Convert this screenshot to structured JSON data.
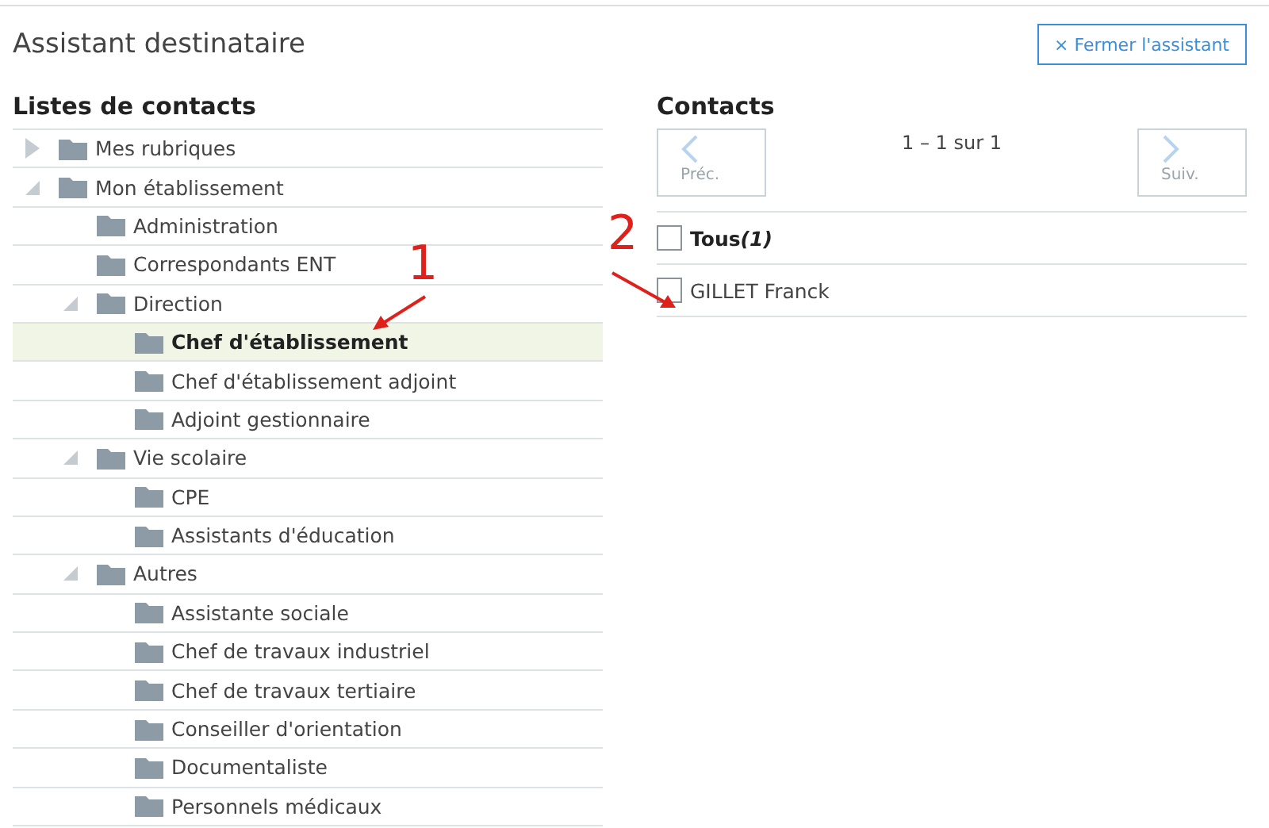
{
  "title": "Assistant destinataire",
  "close_button": {
    "icon": "×",
    "label": "Fermer l'assistant"
  },
  "contact_lists": {
    "heading": "Listes de contacts",
    "items": [
      {
        "label": "Mes rubriques",
        "expanded": false,
        "selected": false
      },
      {
        "label": "Mon établissement",
        "expanded": true,
        "selected": false,
        "children": [
          {
            "label": "Administration",
            "selected": false
          },
          {
            "label": "Correspondants ENT",
            "selected": false
          },
          {
            "label": "Direction",
            "expanded": true,
            "selected": false,
            "children": [
              {
                "label": "Chef d'établissement",
                "selected": true
              },
              {
                "label": "Chef d'établissement adjoint",
                "selected": false
              },
              {
                "label": "Adjoint gestionnaire",
                "selected": false
              }
            ]
          },
          {
            "label": "Vie scolaire",
            "expanded": true,
            "selected": false,
            "children": [
              {
                "label": "CPE",
                "selected": false
              },
              {
                "label": "Assistants d'éducation",
                "selected": false
              }
            ]
          },
          {
            "label": "Autres",
            "expanded": true,
            "selected": false,
            "children": [
              {
                "label": "Assistante sociale",
                "selected": false
              },
              {
                "label": "Chef de travaux industriel",
                "selected": false
              },
              {
                "label": "Chef de travaux tertiaire",
                "selected": false
              },
              {
                "label": "Conseiller d'orientation",
                "selected": false
              },
              {
                "label": "Documentaliste",
                "selected": false
              },
              {
                "label": "Personnels médicaux",
                "selected": false
              }
            ]
          }
        ]
      }
    ]
  },
  "contacts": {
    "heading": "Contacts",
    "prev": {
      "label": "Préc.",
      "disabled": true
    },
    "range": "1 – 1 sur 1",
    "next": {
      "label": "Suiv.",
      "disabled": true
    },
    "all": {
      "label": "Tous",
      "count": "(1)",
      "checked": false
    },
    "rows": [
      {
        "label": "GILLET Franck",
        "checked": false
      }
    ]
  },
  "annotations": [
    {
      "label": "1"
    },
    {
      "label": "2"
    }
  ]
}
